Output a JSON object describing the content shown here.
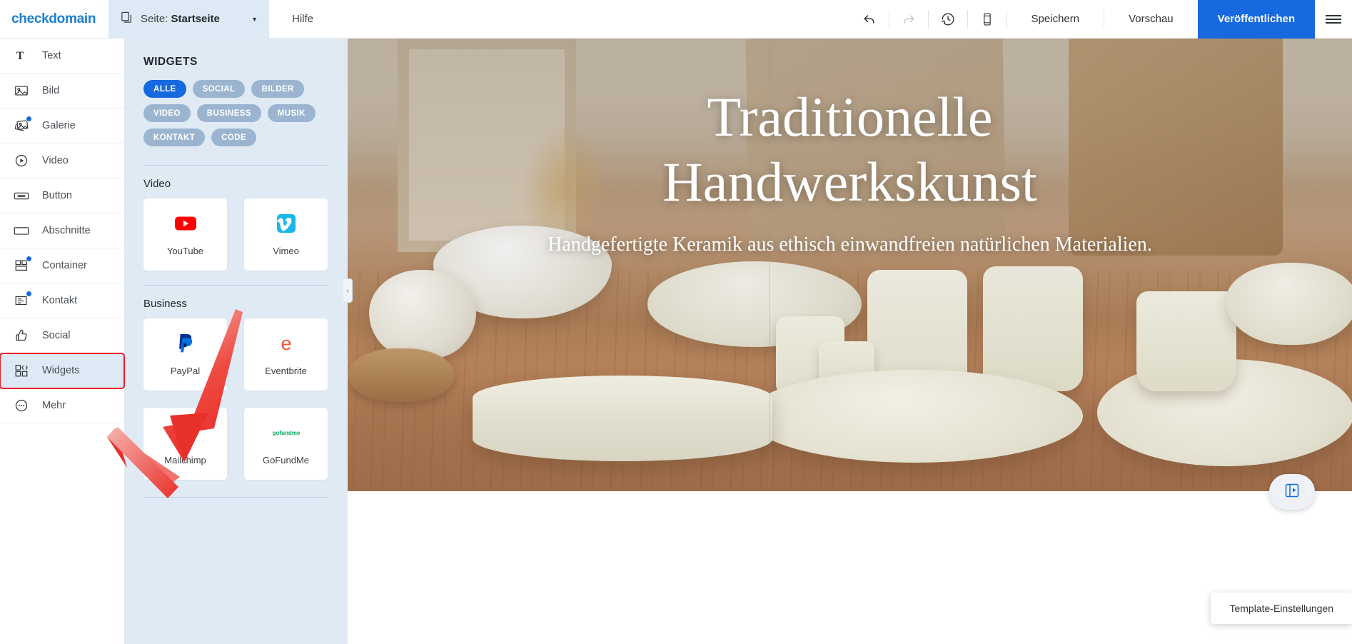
{
  "topbar": {
    "logo_text": "checkdomain",
    "page_selector": {
      "prefix": "Seite:",
      "value": "Startseite",
      "icon": "pages-icon",
      "caret": "chevron-down-icon"
    },
    "help_label": "Hilfe",
    "icons": {
      "undo": "undo-icon",
      "redo": "redo-icon",
      "history": "history-clock-icon",
      "mobile": "mobile-preview-icon",
      "menu": "hamburger-menu-icon"
    },
    "save_label": "Speichern",
    "preview_label": "Vorschau",
    "publish_label": "Veröffentlichen",
    "publish_color": "#1769e0"
  },
  "sidebar": {
    "items": [
      {
        "label": "Text",
        "icon": "text-icon",
        "badge": false,
        "active": false
      },
      {
        "label": "Bild",
        "icon": "image-icon",
        "badge": false,
        "active": false
      },
      {
        "label": "Galerie",
        "icon": "gallery-icon",
        "badge": true,
        "active": false
      },
      {
        "label": "Video",
        "icon": "video-play-icon",
        "badge": false,
        "active": false
      },
      {
        "label": "Button",
        "icon": "button-icon",
        "badge": false,
        "active": false
      },
      {
        "label": "Abschnitte",
        "icon": "sections-icon",
        "badge": false,
        "active": false
      },
      {
        "label": "Container",
        "icon": "container-icon",
        "badge": true,
        "active": false
      },
      {
        "label": "Kontakt",
        "icon": "contact-form-icon",
        "badge": true,
        "active": false
      },
      {
        "label": "Social",
        "icon": "thumbs-up-icon",
        "badge": false,
        "active": false
      },
      {
        "label": "Widgets",
        "icon": "widgets-grid-icon",
        "badge": false,
        "active": true
      },
      {
        "label": "Mehr",
        "icon": "more-dots-icon",
        "badge": false,
        "active": false
      }
    ],
    "badge_color": "#1769e0",
    "highlight_color": "#ee1c25"
  },
  "panel": {
    "title": "WIDGETS",
    "filters": [
      {
        "label": "ALLE",
        "selected": true
      },
      {
        "label": "SOCIAL",
        "selected": false
      },
      {
        "label": "BILDER",
        "selected": false
      },
      {
        "label": "VIDEO",
        "selected": false
      },
      {
        "label": "BUSINESS",
        "selected": false
      },
      {
        "label": "MUSIK",
        "selected": false
      },
      {
        "label": "KONTAKT",
        "selected": false
      },
      {
        "label": "CODE",
        "selected": false
      }
    ],
    "sections": [
      {
        "title": "Video",
        "cards": [
          {
            "label": "YouTube",
            "icon": "youtube-icon"
          },
          {
            "label": "Vimeo",
            "icon": "vimeo-icon"
          }
        ]
      },
      {
        "title": "Business",
        "cards": [
          {
            "label": "PayPal",
            "icon": "paypal-icon"
          },
          {
            "label": "Eventbrite",
            "icon": "eventbrite-icon"
          },
          {
            "label": "Mailchimp",
            "icon": "mailchimp-icon"
          },
          {
            "label": "GoFundMe",
            "icon": "gofundme-icon"
          }
        ]
      }
    ],
    "collapse_glyph": "‹",
    "background": "#dfeaf5",
    "chip_color": "#9bb5d0",
    "chip_selected_color": "#1769e0"
  },
  "canvas": {
    "hero_heading_line1": "Traditionelle",
    "hero_heading_line2": "Handwerkskunst",
    "hero_subtitle": "Handgefertigte Keramik aus ethisch einwandfreien natürlichen Materialien.",
    "fab_icon": "design-palette-icon",
    "toast_label": "Template-Einstellungen"
  }
}
